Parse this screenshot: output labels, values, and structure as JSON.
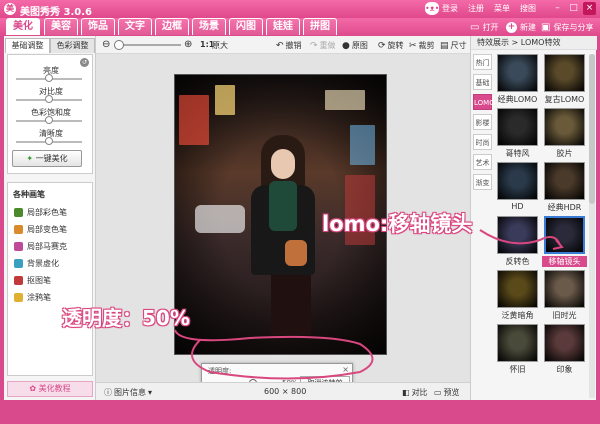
{
  "app": {
    "title": "美图秀秀 3.0.6",
    "top_links": [
      "登录",
      "注册",
      "菜单",
      "搜图"
    ]
  },
  "tabs": [
    "美化",
    "美容",
    "饰品",
    "文字",
    "边框",
    "场景",
    "闪图",
    "娃娃",
    "拼图"
  ],
  "active_tab": "美化",
  "tab_actions": {
    "open": "打开",
    "new": "新建",
    "save": "保存与分享"
  },
  "left_panel": {
    "tabs": [
      "基础调整",
      "色彩调整"
    ],
    "sliders": [
      {
        "label": "亮度",
        "value": 0.5
      },
      {
        "label": "对比度",
        "value": 0.5
      },
      {
        "label": "色彩饱和度",
        "value": 0.5
      },
      {
        "label": "清晰度",
        "value": 0.5
      }
    ],
    "one_key": "一键美化",
    "brushes_title": "各种画笔",
    "brushes": [
      "局部彩色笔",
      "局部变色笔",
      "局部马赛克",
      "背景虚化",
      "抠图笔",
      "涂鸦笔"
    ],
    "tutorial": "美化教程"
  },
  "toolbar": {
    "zoom_ratio": "1:1",
    "original_size": "原大",
    "undo": "撤销",
    "redo": "重做",
    "original_image": "原图",
    "rotate": "旋转",
    "crop": "裁剪",
    "resize": "尺寸"
  },
  "transparency": {
    "title": "透明度:",
    "value_text": "50%",
    "value": 0.5,
    "cancel": "取消该特效"
  },
  "statusbar": {
    "image_info": "图片信息",
    "dimensions": "600 × 800",
    "compare": "对比",
    "preview": "预览"
  },
  "right_panel": {
    "breadcrumb": "特效展示 > LOMO特效",
    "categories": [
      "热门",
      "基础",
      "LOMO",
      "影楼",
      "时尚",
      "艺术",
      "渐变"
    ],
    "active_category": "LOMO",
    "effects": [
      {
        "label": "经典LOMO",
        "color": "#3a4a5a"
      },
      {
        "label": "复古LOMO",
        "color": "#5a4a2a"
      },
      {
        "label": "哥特风",
        "color": "#2a2a2a"
      },
      {
        "label": "胶片",
        "color": "#6a5a3a"
      },
      {
        "label": "HD",
        "color": "#2a3a4a"
      },
      {
        "label": "经典HDR",
        "color": "#4a3a2a"
      },
      {
        "label": "反转色",
        "color": "#3a3a5a"
      },
      {
        "label": "移轴镜头",
        "color": "#2a2a3a"
      },
      {
        "label": "泛黄暗角",
        "color": "#5a4a1a"
      },
      {
        "label": "旧时光",
        "color": "#6a5a4a"
      },
      {
        "label": "怀旧",
        "color": "#4a4a3a"
      },
      {
        "label": "印象",
        "color": "#5a3a3a"
      }
    ],
    "selected_effect": "移轴镜头"
  },
  "annotations": {
    "lomo": "lomo:移轴镜头",
    "transparency": "透明度：50%"
  },
  "colors": {
    "brand": "#d94a8c",
    "selection": "#3a7bd5"
  }
}
